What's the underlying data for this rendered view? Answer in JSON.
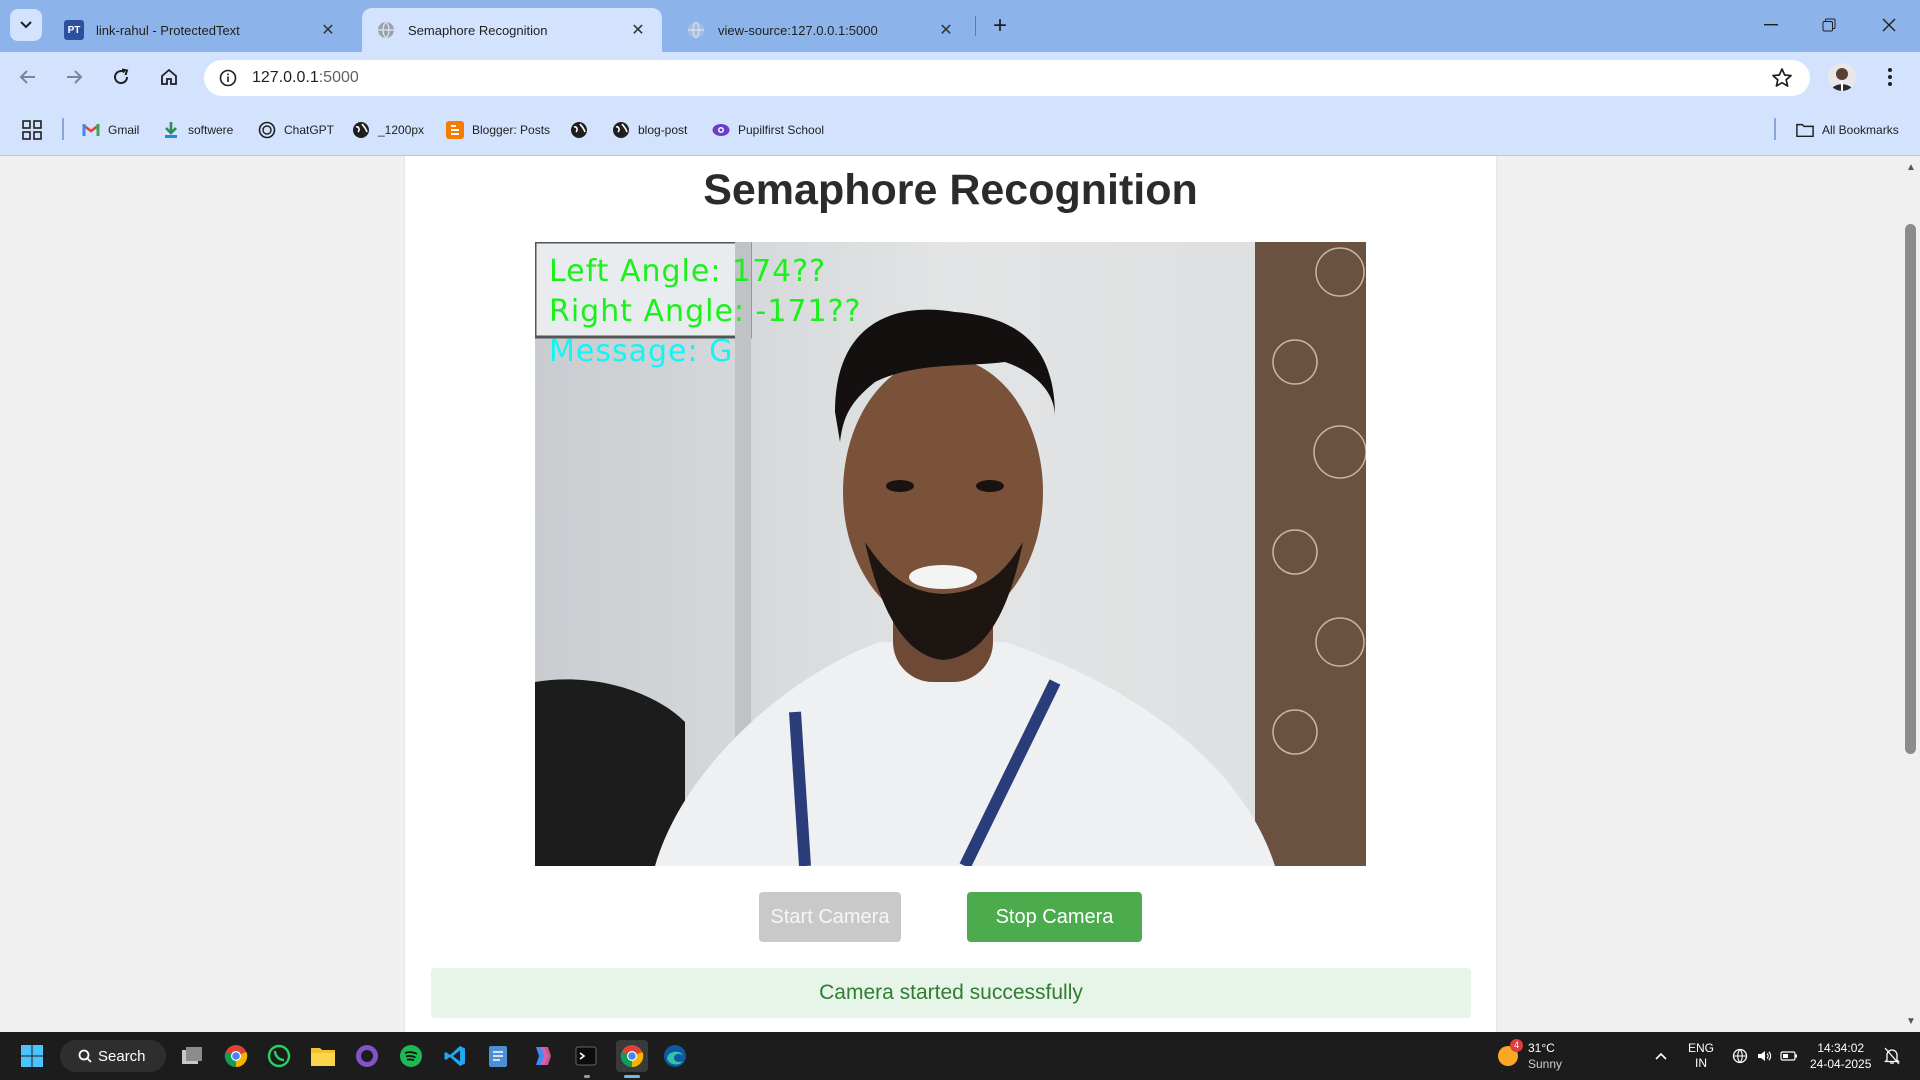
{
  "browser": {
    "tabs": [
      {
        "title": "link-rahul - ProtectedText",
        "favicon": "pt-favicon",
        "active": false
      },
      {
        "title": "Semaphore Recognition",
        "favicon": "globe-icon",
        "active": true
      },
      {
        "title": "view-source:127.0.0.1:5000",
        "favicon": "globe-icon",
        "active": false
      }
    ],
    "url_host": "127.0.0.1",
    "url_port": ":5000",
    "pt_badge": "PT"
  },
  "bookmarks": [
    {
      "label": "Gmail",
      "icon": "gmail-icon"
    },
    {
      "label": "softwere",
      "icon": "download-icon"
    },
    {
      "label": "ChatGPT",
      "icon": "chatgpt-icon"
    },
    {
      "label": "_1200px",
      "icon": "globe-icon"
    },
    {
      "label": "Blogger: Posts",
      "icon": "blogger-icon"
    },
    {
      "label": "",
      "icon": "globe-icon"
    },
    {
      "label": "blog-post",
      "icon": "globe-icon"
    },
    {
      "label": "Pupilfirst School",
      "icon": "pupilfirst-icon"
    }
  ],
  "all_bookmarks": "All Bookmarks",
  "page": {
    "title": "Semaphore Recognition",
    "overlay": {
      "left_angle": "Left Angle: 174??",
      "right_angle": "Right Angle: -171??",
      "message": "Message: G"
    },
    "start_button": "Start Camera",
    "stop_button": "Stop Camera",
    "status": "Camera started successfully"
  },
  "taskbar": {
    "search_label": "Search",
    "weather_badge": "4",
    "weather_temp": "31°C",
    "weather_desc": "Sunny",
    "lang_top": "ENG",
    "lang_bottom": "IN",
    "time": "14:34:02",
    "date": "24-04-2025"
  },
  "colors": {
    "tab_strip": "#8db4ea",
    "toolbar": "#d3e3fd",
    "stop_button": "#4bab4d",
    "start_button_disabled": "#c9c9c9",
    "status_bg": "#e7f4e8",
    "status_text": "#2e7d32",
    "overlay_green": "#19f219",
    "overlay_cyan": "#13f4f4"
  }
}
